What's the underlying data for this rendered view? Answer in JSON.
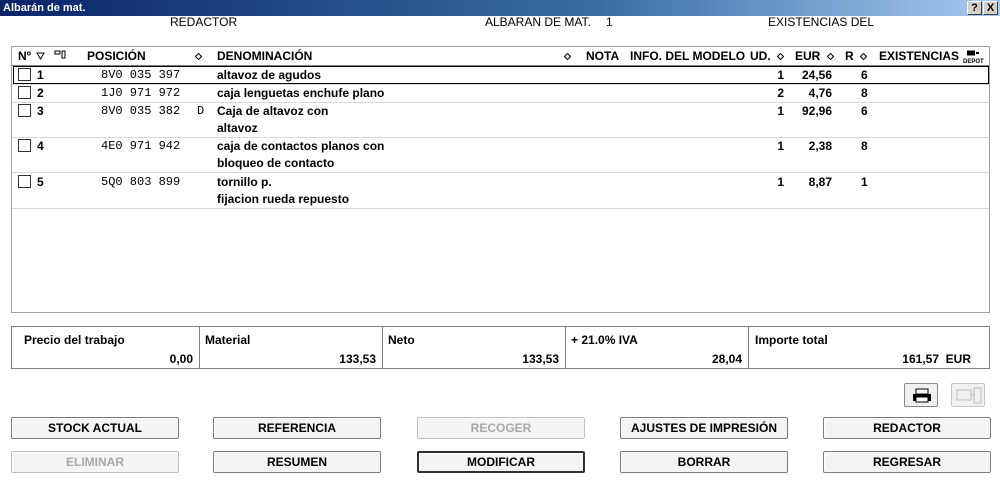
{
  "window": {
    "title": "Albarán de mat.",
    "help": "?",
    "close": "X"
  },
  "header": {
    "redactor": "REDACTOR",
    "albaran_label": "ALBARAN DE MAT.",
    "albaran_number": "1",
    "existencias": "EXISTENCIAS DEL"
  },
  "columns": {
    "no": "Nº",
    "posicion": "POSICIÓN",
    "denominacion": "DENOMINACIÓN",
    "nota": "NOTA",
    "info": "INFO. DEL MODELO",
    "ud": "UD.",
    "eur": "EUR",
    "r": "R",
    "existencias": "EXISTENCIAS",
    "depot": "DEPOT"
  },
  "rows": [
    {
      "no": "1",
      "pos": "8V0 035 397",
      "flag": "",
      "den1": "altavoz de agudos",
      "den2": "",
      "ud": "1",
      "eur": "24,56",
      "r": "6"
    },
    {
      "no": "2",
      "pos": "1J0 971 972",
      "flag": "",
      "den1": "caja lenguetas enchufe plano",
      "den2": "",
      "ud": "2",
      "eur": "4,76",
      "r": "8"
    },
    {
      "no": "3",
      "pos": "8V0 035 382",
      "flag": "D",
      "den1": "Caja de altavoz con",
      "den2": "altavoz",
      "ud": "1",
      "eur": "92,96",
      "r": "6"
    },
    {
      "no": "4",
      "pos": "4E0 971 942",
      "flag": "",
      "den1": "caja de contactos planos con",
      "den2": "bloqueo de contacto",
      "ud": "1",
      "eur": "2,38",
      "r": "8"
    },
    {
      "no": "5",
      "pos": "5Q0 803 899",
      "flag": "",
      "den1": "tornillo p.",
      "den2": "fijacion rueda repuesto",
      "ud": "1",
      "eur": "8,87",
      "r": "1"
    }
  ],
  "totals": {
    "trabajo_label": "Precio del trabajo",
    "trabajo_value": "0,00",
    "material_label": "Material",
    "material_value": "133,53",
    "neto_label": "Neto",
    "neto_value": "133,53",
    "iva_label": "+ 21.0% IVA",
    "iva_value": "28,04",
    "total_label": "Importe total",
    "total_value": "161,57",
    "currency": "EUR"
  },
  "buttons": {
    "stock": "STOCK ACTUAL",
    "referencia": "REFERENCIA",
    "recoger": "RECOGER",
    "ajustes": "AJUSTES DE IMPRESIÓN",
    "redactor": "REDACTOR",
    "eliminar": "ELIMINAR",
    "resumen": "RESUMEN",
    "modificar": "MODIFICAR",
    "borrar": "BORRAR",
    "regresar": "REGRESAR"
  },
  "icons": {
    "print": "printer-icon",
    "device": "device-icon"
  }
}
